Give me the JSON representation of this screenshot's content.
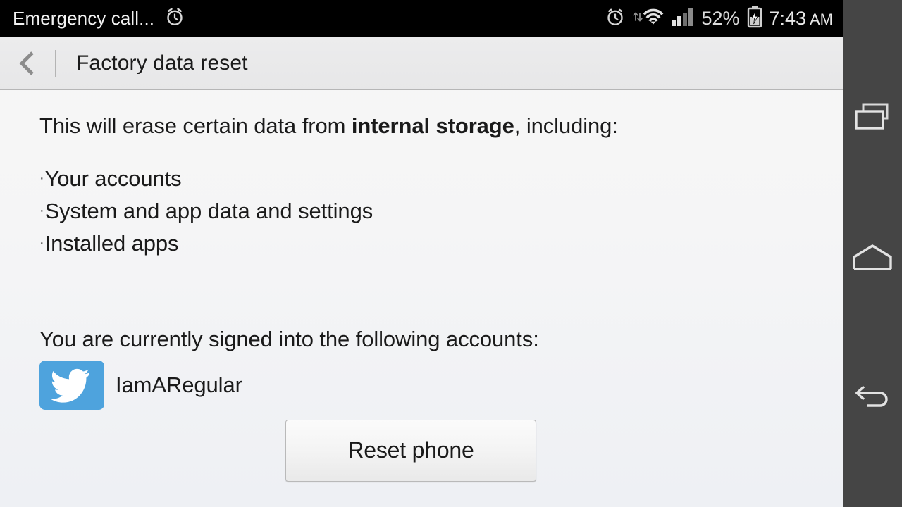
{
  "statusbar": {
    "left_text": "Emergency call...",
    "alarm_icon_left": "alarm-clock-icon",
    "alarm_icon_right": "alarm-clock-icon",
    "wifi_icon": "wifi-icon",
    "signal_icon": "cellular-signal-icon",
    "battery_percent": "52%",
    "battery_icon": "battery-charging-icon",
    "clock_time": "7:43",
    "clock_ampm": "AM"
  },
  "actionbar": {
    "back_icon": "back-chevron-icon",
    "title": "Factory data reset"
  },
  "content": {
    "intro_prefix": "This will erase certain data from ",
    "intro_bold": "internal storage",
    "intro_suffix": ", including:",
    "bullet_char": "·",
    "bullets": [
      "Your accounts",
      "System and app data and settings",
      "Installed apps"
    ],
    "accounts_label": "You are currently signed into the following accounts:",
    "accounts": [
      {
        "icon": "twitter-icon",
        "name": "IamARegular"
      }
    ],
    "reset_button_label": "Reset phone"
  },
  "navbar": {
    "recents_icon": "recents-icon",
    "home_icon": "home-icon",
    "back_icon": "back-arrow-icon"
  },
  "colors": {
    "statusbar_bg": "#000000",
    "actionbar_bg": "#ececed",
    "content_bg": "#f5f5f6",
    "navbar_bg": "#454545",
    "twitter_blue": "#4ea3dd",
    "text_primary": "#1a1a1a"
  }
}
